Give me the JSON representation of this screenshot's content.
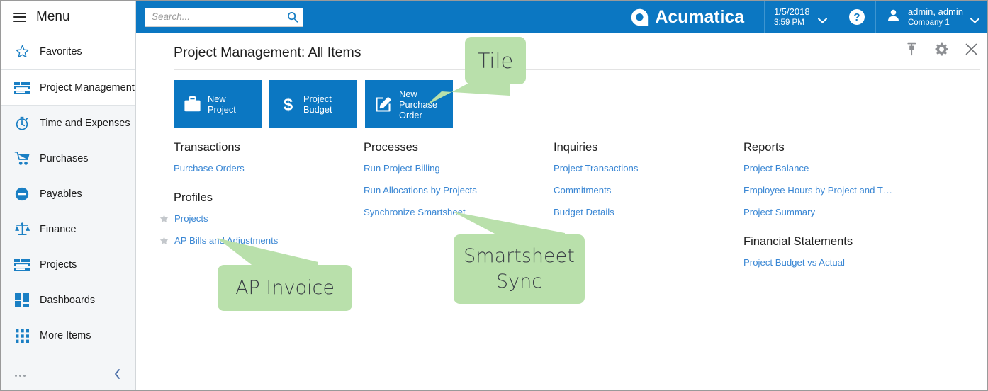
{
  "header": {
    "search": {
      "placeholder": "Search...",
      "value": "",
      "icon": "search-icon"
    },
    "brand": {
      "name": "Acumatica",
      "icon": "acumatica-logo-icon"
    },
    "datetime": {
      "date": "1/5/2018",
      "time": "3:59 PM",
      "chevron": "chevron-down-icon"
    },
    "help": {
      "label": "?",
      "icon": "help-icon"
    },
    "user": {
      "name": "admin, admin",
      "company": "Company 1",
      "icon": "user-avatar-icon",
      "chevron": "chevron-down-icon"
    },
    "accent_color": "#0b77c2"
  },
  "sidebar": {
    "menu_label": "Menu",
    "menu_icon": "hamburger-icon",
    "favorites": {
      "label": "Favorites",
      "icon": "star-icon"
    },
    "items": [
      {
        "label": "Project Management",
        "icon": "list-lines-icon",
        "active": true
      },
      {
        "label": "Time and Expenses",
        "icon": "stopwatch-icon",
        "active": false
      },
      {
        "label": "Purchases",
        "icon": "shopping-cart-icon",
        "active": false
      },
      {
        "label": "Payables",
        "icon": "minus-circle-icon",
        "active": false
      },
      {
        "label": "Finance",
        "icon": "scales-balance-icon",
        "active": false
      },
      {
        "label": "Projects",
        "icon": "list-lines-icon",
        "active": false
      },
      {
        "label": "Dashboards",
        "icon": "grid-blocks-icon",
        "active": false
      },
      {
        "label": "More Items",
        "icon": "dots-grid-icon",
        "active": false
      }
    ],
    "footer": {
      "more_icon": "ellipsis-icon",
      "collapse_icon": "chevron-left-icon"
    }
  },
  "main": {
    "title": "Project Management: All Items",
    "window_actions": [
      {
        "name": "pin-icon",
        "label": "Pin"
      },
      {
        "name": "gear-icon",
        "label": "Settings"
      },
      {
        "name": "close-icon",
        "label": "Close"
      }
    ],
    "tiles": [
      {
        "line1": "New",
        "line2": "Project",
        "line3": "",
        "icon": "briefcase-icon"
      },
      {
        "line1": "Project",
        "line2": "Budget",
        "line3": "",
        "icon": "dollar-icon"
      },
      {
        "line1": "New",
        "line2": "Purchase",
        "line3": "Order",
        "icon": "edit-pencil-icon"
      }
    ],
    "columns": [
      {
        "groups": [
          {
            "title": "Transactions",
            "links": [
              {
                "label": "Purchase Orders",
                "starred": false
              }
            ]
          },
          {
            "title": "Profiles",
            "links": [
              {
                "label": "Projects",
                "starred": true
              },
              {
                "label": "AP Bills and Adjustments",
                "starred": true
              }
            ]
          }
        ]
      },
      {
        "groups": [
          {
            "title": "Processes",
            "links": [
              {
                "label": "Run Project Billing",
                "starred": false
              },
              {
                "label": "Run Allocations by Projects",
                "starred": false
              },
              {
                "label": "Synchronize Smartsheet",
                "starred": false
              }
            ]
          }
        ]
      },
      {
        "groups": [
          {
            "title": "Inquiries",
            "links": [
              {
                "label": "Project Transactions",
                "starred": false
              },
              {
                "label": "Commitments",
                "starred": false
              },
              {
                "label": "Budget Details",
                "starred": false
              }
            ]
          }
        ]
      },
      {
        "groups": [
          {
            "title": "Reports",
            "links": [
              {
                "label": "Project Balance",
                "starred": false
              },
              {
                "label": "Employee Hours by Project and T…",
                "starred": false
              },
              {
                "label": "Project Summary",
                "starred": false
              }
            ]
          },
          {
            "title": "Financial Statements",
            "links": [
              {
                "label": "Project Budget vs Actual",
                "starred": false
              }
            ]
          }
        ]
      }
    ]
  },
  "callouts": [
    {
      "text": "Tile",
      "lines": [
        "Tile"
      ]
    },
    {
      "text": "AP Invoice",
      "lines": [
        "AP Invoice"
      ]
    },
    {
      "text": "Smartsheet Sync",
      "lines": [
        "Smartsheet",
        "Sync"
      ]
    }
  ],
  "colors": {
    "accent": "#0b77c2",
    "link": "#3a87d4",
    "callout": "#b9e0ab",
    "sidebar_bg": "#f4f6f8",
    "tile": "#0b77c2"
  }
}
